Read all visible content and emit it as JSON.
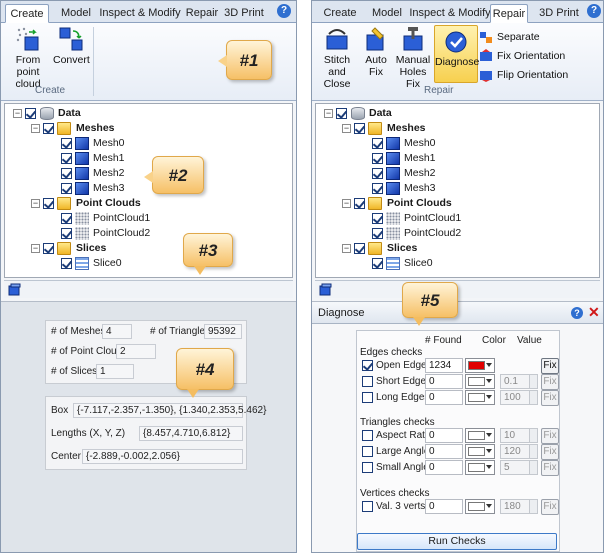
{
  "left": {
    "tabs": [
      {
        "label": "Create",
        "active": true
      },
      {
        "label": "Model"
      },
      {
        "label": "Inspect & Modify"
      },
      {
        "label": "Repair"
      },
      {
        "label": "3D Print"
      }
    ],
    "ribbon": {
      "buttons": [
        {
          "label_line1": "From point",
          "label_line2": "cloud"
        },
        {
          "label_line1": "Convert",
          "label_line2": ""
        }
      ],
      "group_label": "Create"
    },
    "tree": {
      "root": "Data",
      "meshes_label": "Meshes",
      "meshes": [
        "Mesh0",
        "Mesh1",
        "Mesh2",
        "Mesh3"
      ],
      "pointclouds_label": "Point Clouds",
      "pointclouds": [
        "PointCloud1",
        "PointCloud2"
      ],
      "slices_label": "Slices",
      "slices": [
        "Slice0"
      ]
    },
    "info": {
      "meshes_label": "# of Meshes",
      "meshes_value": "4",
      "triangles_label": "# of Triangles",
      "triangles_value": "95392",
      "pointclouds_label": "# of Point Clouds",
      "pointclouds_value": "2",
      "slices_label": "# of Slices",
      "slices_value": "1",
      "box_label": "Box",
      "box_value": "{-7.117,-2.357,-1.350}, {1.340,2.353,5.462}",
      "lengths_label": "Lengths (X, Y, Z)",
      "lengths_value": "{8.457,4.710,6.812}",
      "center_label": "Center",
      "center_value": "{-2.889,-0.002,2.056}"
    },
    "callouts": [
      "#1",
      "#2",
      "#3",
      "#4"
    ]
  },
  "right": {
    "tabs": [
      {
        "label": "Create"
      },
      {
        "label": "Model"
      },
      {
        "label": "Inspect & Modify"
      },
      {
        "label": "Repair",
        "active": true
      },
      {
        "label": "3D Print"
      }
    ],
    "ribbon": {
      "buttons": [
        {
          "label_line1": "Stitch and",
          "label_line2": "Close"
        },
        {
          "label_line1": "Auto",
          "label_line2": "Fix"
        },
        {
          "label_line1": "Manual",
          "label_line2": "Holes Fix"
        },
        {
          "label_line1": "Diagnose",
          "label_line2": ""
        }
      ],
      "small_buttons": [
        "Separate",
        "Fix Orientation",
        "Flip Orientation"
      ],
      "group_label": "Repair"
    },
    "tree": {
      "root": "Data",
      "meshes_label": "Meshes",
      "meshes": [
        "Mesh0",
        "Mesh1",
        "Mesh2",
        "Mesh3"
      ],
      "pointclouds_label": "Point Clouds",
      "pointclouds": [
        "PointCloud1",
        "PointCloud2"
      ],
      "slices_label": "Slices",
      "slices": [
        "Slice0"
      ]
    },
    "diagnose": {
      "title": "Diagnose",
      "col_found": "# Found",
      "col_color": "Color",
      "col_value": "Value",
      "edges_title": "Edges checks",
      "edges": [
        {
          "label": "Open Edges",
          "checked": true,
          "found": "1234",
          "color": "#e00000",
          "value": "",
          "fix": true
        },
        {
          "label": "Short Edges",
          "checked": false,
          "found": "0",
          "color": "#ffffff",
          "value": "0.1",
          "fix": false
        },
        {
          "label": "Long Edges",
          "checked": false,
          "found": "0",
          "color": "#ffffff",
          "value": "100",
          "fix": false
        }
      ],
      "triangles_title": "Triangles checks",
      "triangles": [
        {
          "label": "Aspect Ratio",
          "checked": false,
          "found": "0",
          "color": "#ffffff",
          "value": "10",
          "fix": false
        },
        {
          "label": "Large Angles",
          "checked": false,
          "found": "0",
          "color": "#ffffff",
          "value": "120",
          "fix": false
        },
        {
          "label": "Small Angles",
          "checked": false,
          "found": "0",
          "color": "#ffffff",
          "value": "5",
          "fix": false
        }
      ],
      "vertices_title": "Vertices checks",
      "vertices": [
        {
          "label": "Val. 3 verts",
          "checked": false,
          "found": "0",
          "color": "#ffffff",
          "value": "180",
          "fix": false
        }
      ],
      "fix_label": "Fix",
      "run_label": "Run Checks"
    },
    "callouts": [
      "#5"
    ]
  }
}
